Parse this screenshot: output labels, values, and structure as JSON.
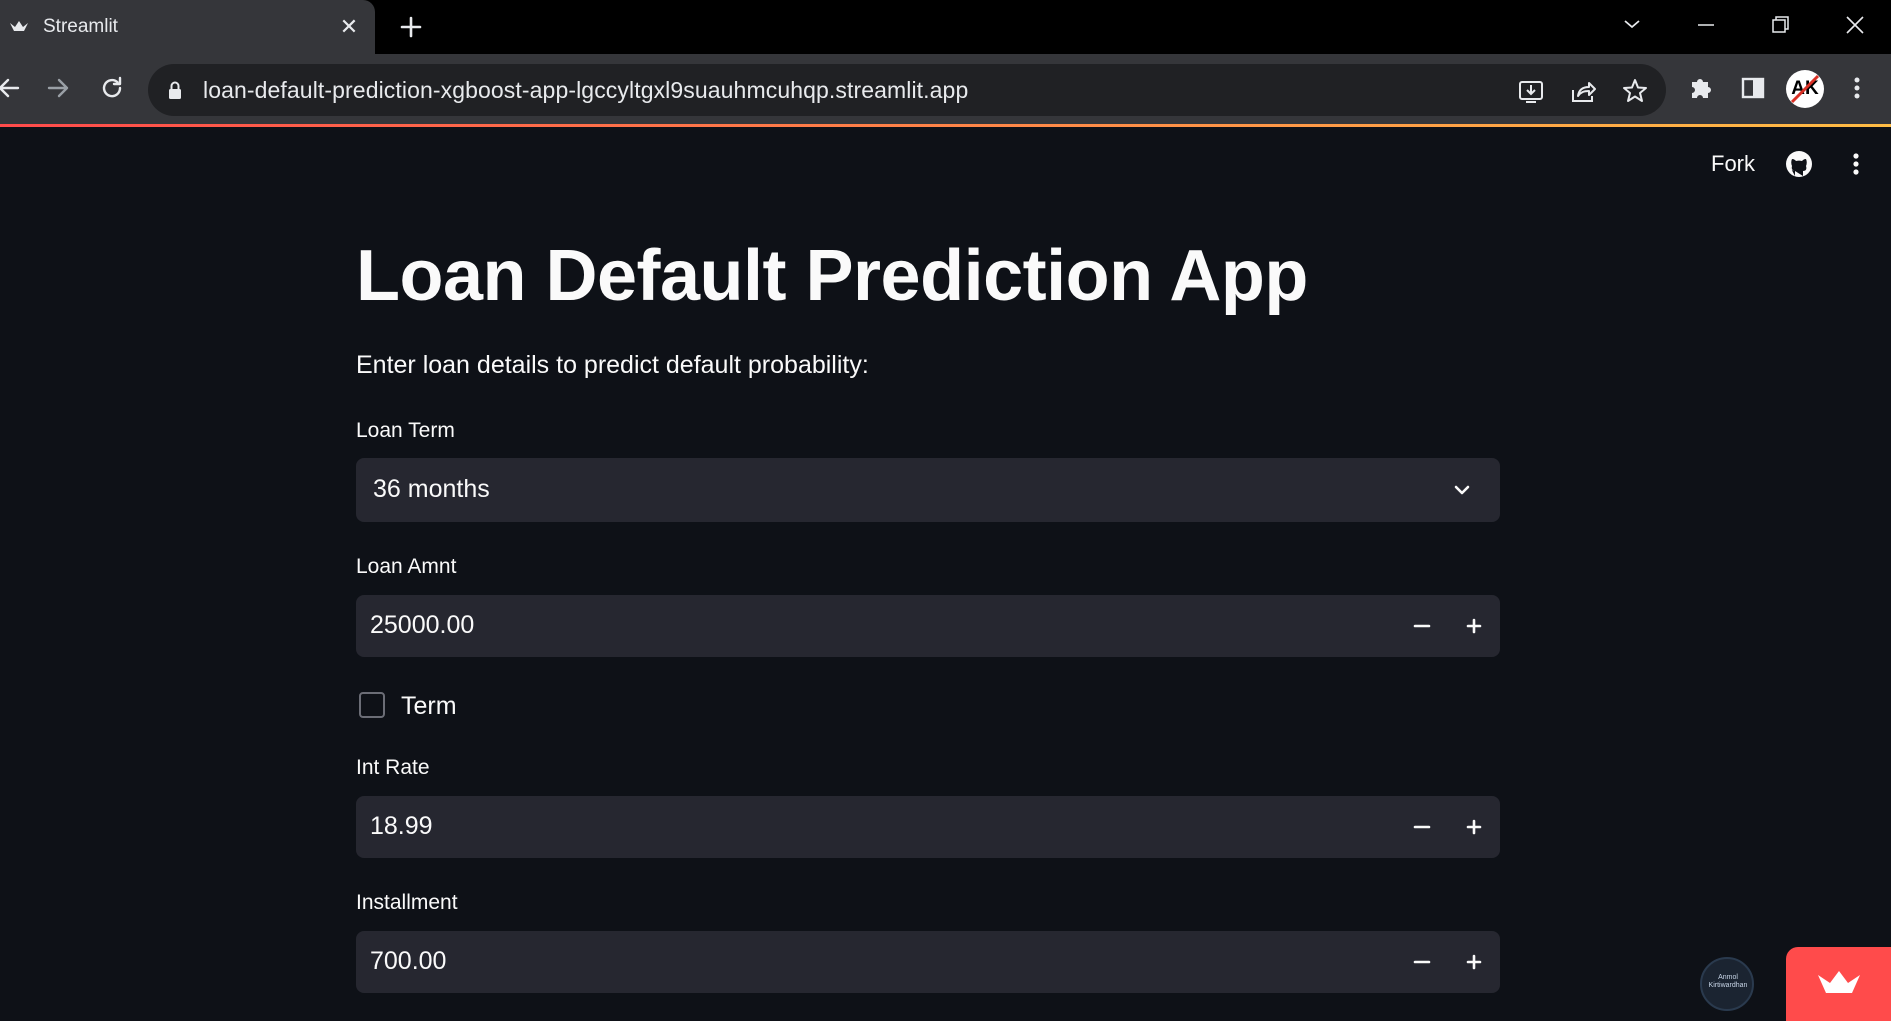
{
  "browser": {
    "tab_title": "Streamlit",
    "url": "loan-default-prediction-xgboost-app-lgccyltgxl9suauhmcuhqp.streamlit.app",
    "profile_initials": "AK"
  },
  "header": {
    "fork_label": "Fork"
  },
  "main": {
    "title": "Loan Default Prediction App",
    "subtitle": "Enter loan details to predict default probability:",
    "loan_term": {
      "label": "Loan Term",
      "value": "36 months"
    },
    "loan_amnt": {
      "label": "Loan Amnt",
      "value": "25000.00"
    },
    "term_checkbox": {
      "label": "Term",
      "checked": false
    },
    "int_rate": {
      "label": "Int Rate",
      "value": "18.99"
    },
    "installment": {
      "label": "Installment",
      "value": "700.00"
    }
  },
  "badge": {
    "text": "Anmol Kirtiwardhan"
  },
  "colors": {
    "app_bg": "#0e1117",
    "input_bg": "#262730",
    "accent": "#ff4b4b",
    "text": "#fafafa"
  }
}
